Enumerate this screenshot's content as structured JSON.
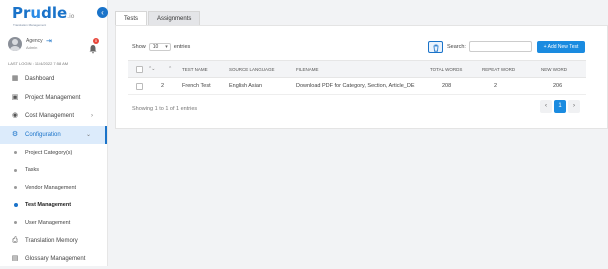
{
  "brand": {
    "name_prefix": "Pr",
    "name_o": "u",
    "name_suffix": "dle",
    "suffix_small": ".io",
    "tagline": "Translation Management"
  },
  "user": {
    "name": "Agency",
    "role": "Admin",
    "notification_count": "0",
    "last_login": "LAST LOGIN : 11/4/2022 7:58 AM"
  },
  "nav": {
    "dashboard": "Dashboard",
    "project_management": "Project Management",
    "cost_management": "Cost Management",
    "configuration": "Configuration",
    "sub": {
      "project_category": "Project Category(s)",
      "tasks": "Tasks",
      "vendor_management": "Vendor Management",
      "test_management": "Test Management",
      "user_management": "User Management"
    },
    "translation_memory": "Translation Memory",
    "glossary_management": "Glossary Management"
  },
  "tabs": [
    {
      "label": "Tests"
    },
    {
      "label": "Assignments"
    }
  ],
  "controls": {
    "show_label": "Show",
    "page_size": "10",
    "entries_label": "entries",
    "search_label": "Search:",
    "search_value": "",
    "add_button": "+ Add New Test"
  },
  "table": {
    "headers": {
      "test_name": "TEST NAME",
      "source_language": "SOURCE LANGUAGE",
      "filename": "FILENAME",
      "total_words": "TOTAL WORDS",
      "repeat_word": "REPEAT WORD",
      "new_word": "NEW WORD"
    },
    "rows": [
      {
        "index": "2",
        "test_name": "French Test",
        "source_language": "English Asian",
        "filename": "Download PDF for Category, Section, Article_DE",
        "total_words": "208",
        "repeat_word": "2",
        "new_word": "206"
      }
    ]
  },
  "footer": {
    "showing": "Showing 1 to 1 of 1 entries",
    "current_page": "1",
    "prev": "‹",
    "next": "›"
  },
  "colors": {
    "accent": "#1a8be0",
    "badge": "#e8463a"
  }
}
